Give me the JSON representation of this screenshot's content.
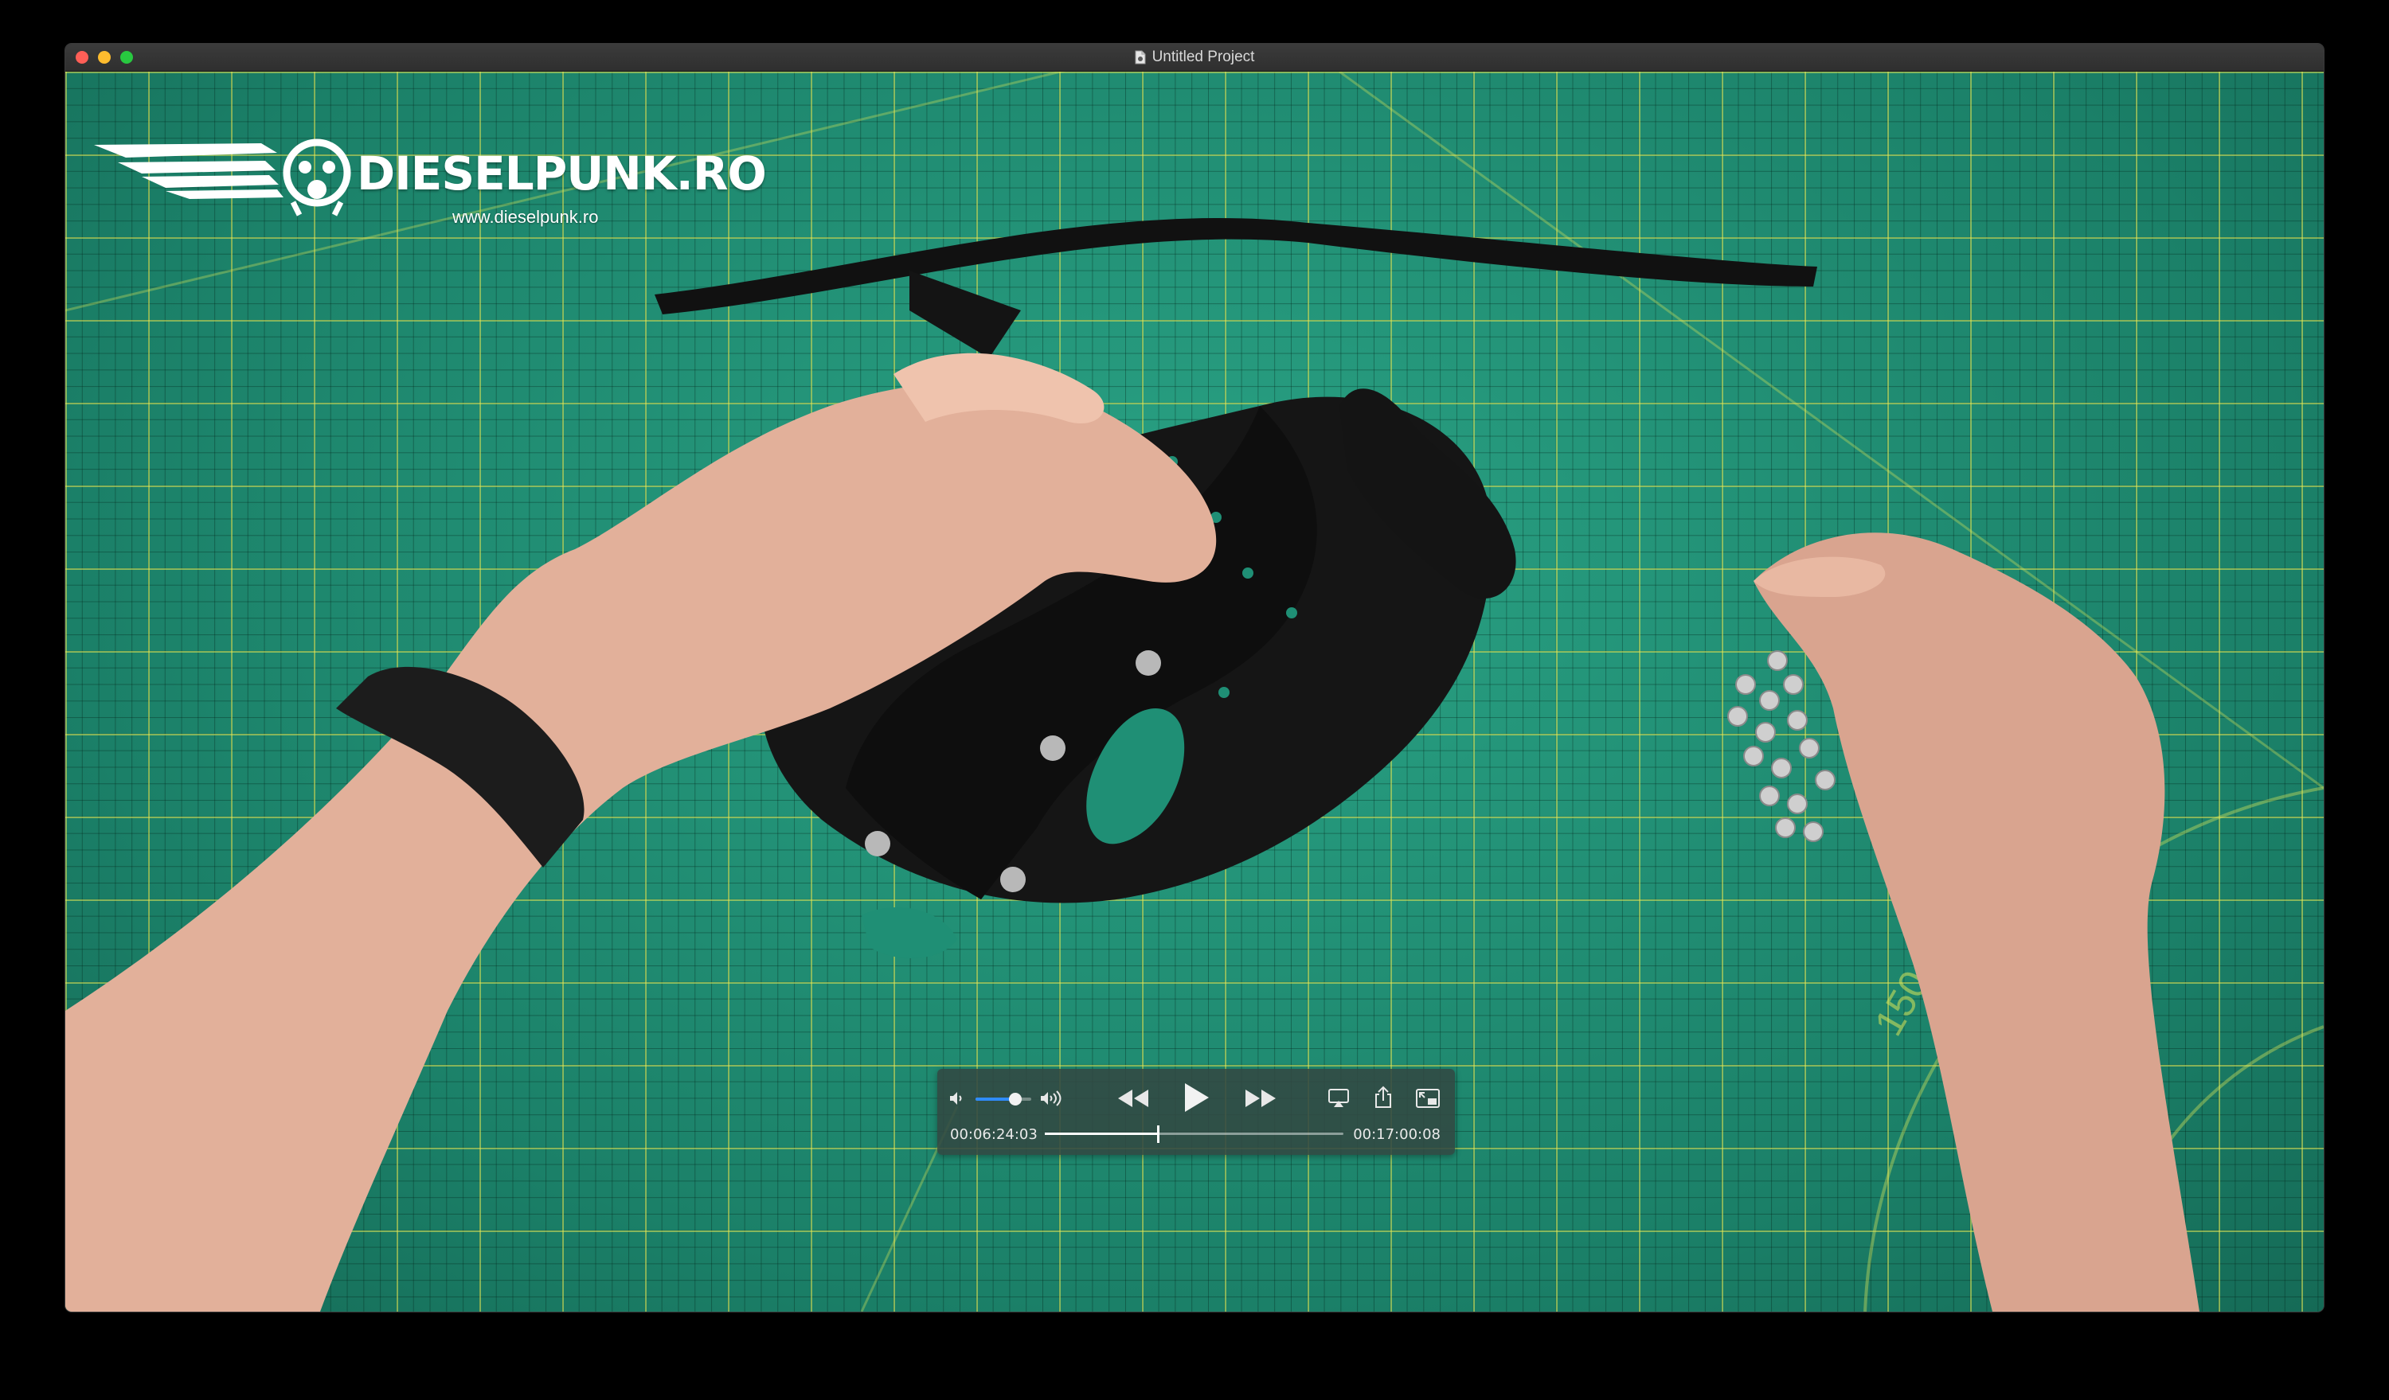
{
  "window": {
    "title": "Untitled Project"
  },
  "overlay": {
    "brand": "DIESELPUNK.RO",
    "url": "www.dieselpunk.ro"
  },
  "player": {
    "current_time": "00:06:24:03",
    "total_time": "00:17:00:08",
    "volume_fraction": 0.72,
    "progress_fraction": 0.378,
    "icons": [
      "volume-low-icon",
      "volume-high-icon",
      "rewind-icon",
      "play-icon",
      "fast-forward-icon",
      "airplay-icon",
      "share-icon",
      "picture-in-picture-icon"
    ]
  },
  "colors": {
    "mat": "#1f8f75",
    "grid": "#e1eb5a",
    "accent": "#2f8cff"
  }
}
